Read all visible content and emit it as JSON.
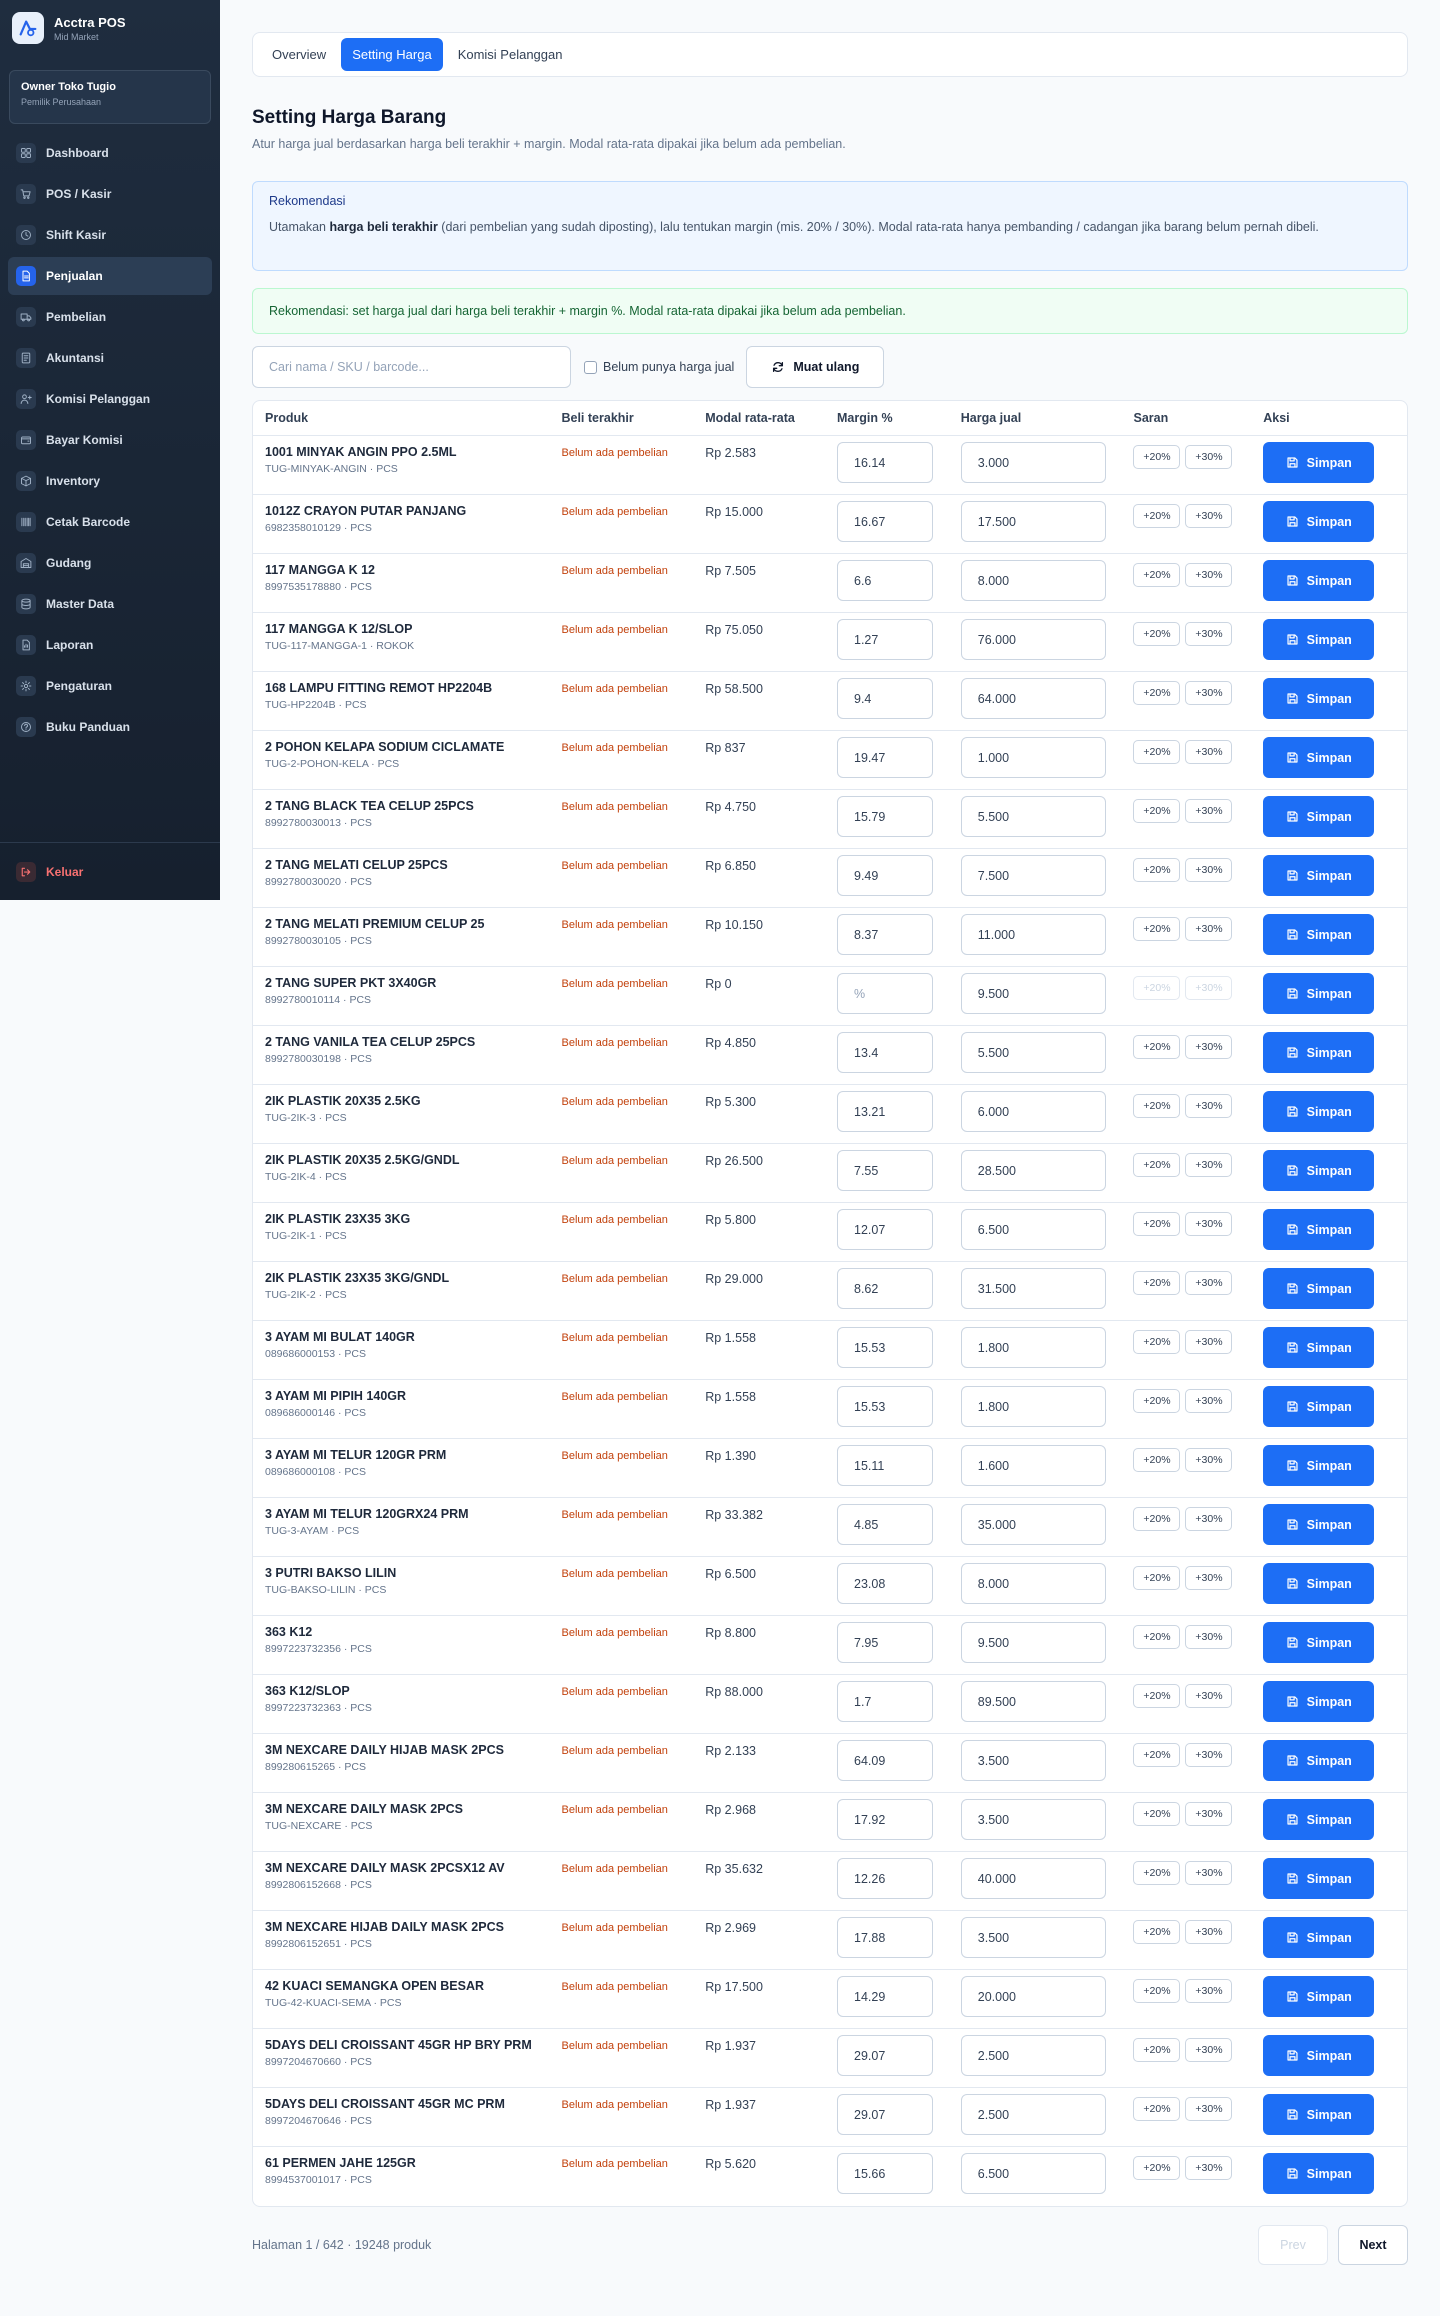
{
  "brand": {
    "name": "Acctra POS",
    "tier": "Mid Market"
  },
  "owner": {
    "name": "Owner Toko Tugio",
    "role": "Pemilik Perusahaan"
  },
  "nav": [
    {
      "label": "Dashboard",
      "icon": "dashboard-icon"
    },
    {
      "label": "POS / Kasir",
      "icon": "cart-icon"
    },
    {
      "label": "Shift Kasir",
      "icon": "clock-icon"
    },
    {
      "label": "Penjualan",
      "icon": "document-icon",
      "active": true
    },
    {
      "label": "Pembelian",
      "icon": "truck-icon"
    },
    {
      "label": "Akuntansi",
      "icon": "ledger-icon"
    },
    {
      "label": "Komisi Pelanggan",
      "icon": "user-commission-icon"
    },
    {
      "label": "Bayar Komisi",
      "icon": "wallet-icon"
    },
    {
      "label": "Inventory",
      "icon": "box-icon"
    },
    {
      "label": "Cetak Barcode",
      "icon": "barcode-icon"
    },
    {
      "label": "Gudang",
      "icon": "warehouse-icon"
    },
    {
      "label": "Master Data",
      "icon": "database-icon"
    },
    {
      "label": "Laporan",
      "icon": "report-icon"
    },
    {
      "label": "Pengaturan",
      "icon": "gear-icon"
    },
    {
      "label": "Buku Panduan",
      "icon": "help-icon"
    }
  ],
  "logout_label": "Keluar",
  "tabs": [
    {
      "label": "Overview"
    },
    {
      "label": "Setting Harga",
      "active": true
    },
    {
      "label": "Komisi Pelanggan"
    }
  ],
  "page": {
    "title": "Setting Harga Barang",
    "description": "Atur harga jual berdasarkan harga beli terakhir + margin. Modal rata-rata dipakai jika belum ada pembelian."
  },
  "info": {
    "title": "Rekomendasi",
    "text_before": "Utamakan ",
    "text_bold": "harga beli terakhir",
    "text_after": " (dari pembelian yang sudah diposting), lalu tentukan margin (mis. 20% / 30%). Modal rata-rata hanya pembanding / cadangan jika barang belum pernah dibeli."
  },
  "success_text": "Rekomendasi: set harga jual dari harga beli terakhir + margin %. Modal rata-rata dipakai jika belum ada pembelian.",
  "filters": {
    "search_placeholder": "Cari nama / SKU / barcode...",
    "checkbox_label": "Belum punya harga jual",
    "reload_label": "Muat ulang"
  },
  "table": {
    "headers": [
      "Produk",
      "Beli terakhir",
      "Modal rata-rata",
      "Margin %",
      "Harga jual",
      "Saran",
      "Aksi"
    ],
    "chip_20": "+20%",
    "chip_30": "+30%",
    "save_label": "Simpan",
    "margin_placeholder": "%",
    "rows": [
      {
        "name": "1001 MINYAK ANGIN PPO 2.5ML",
        "sku": "TUG-MINYAK-ANGIN · PCS",
        "beli": "Belum ada pembelian",
        "modal": "Rp 2.583",
        "margin": "16.14",
        "harga": "3.000"
      },
      {
        "name": "1012Z CRAYON PUTAR PANJANG",
        "sku": "6982358010129 · PCS",
        "beli": "Belum ada pembelian",
        "modal": "Rp 15.000",
        "margin": "16.67",
        "harga": "17.500"
      },
      {
        "name": "117 MANGGA K 12",
        "sku": "8997535178880 · PCS",
        "beli": "Belum ada pembelian",
        "modal": "Rp 7.505",
        "margin": "6.6",
        "harga": "8.000"
      },
      {
        "name": "117 MANGGA K 12/SLOP",
        "sku": "TUG-117-MANGGA-1 · ROKOK",
        "beli": "Belum ada pembelian",
        "modal": "Rp 75.050",
        "margin": "1.27",
        "harga": "76.000"
      },
      {
        "name": "168 LAMPU FITTING REMOT HP2204B",
        "sku": "TUG-HP2204B · PCS",
        "beli": "Belum ada pembelian",
        "modal": "Rp 58.500",
        "margin": "9.4",
        "harga": "64.000"
      },
      {
        "name": "2 POHON KELAPA SODIUM CICLAMATE",
        "sku": "TUG-2-POHON-KELA · PCS",
        "beli": "Belum ada pembelian",
        "modal": "Rp 837",
        "margin": "19.47",
        "harga": "1.000"
      },
      {
        "name": "2 TANG BLACK TEA CELUP 25PCS",
        "sku": "8992780030013 · PCS",
        "beli": "Belum ada pembelian",
        "modal": "Rp 4.750",
        "margin": "15.79",
        "harga": "5.500"
      },
      {
        "name": "2 TANG MELATI CELUP 25PCS",
        "sku": "8992780030020 · PCS",
        "beli": "Belum ada pembelian",
        "modal": "Rp 6.850",
        "margin": "9.49",
        "harga": "7.500"
      },
      {
        "name": "2 TANG MELATI PREMIUM CELUP 25",
        "sku": "8992780030105 · PCS",
        "beli": "Belum ada pembelian",
        "modal": "Rp 10.150",
        "margin": "8.37",
        "harga": "11.000"
      },
      {
        "name": "2 TANG SUPER PKT 3X40GR",
        "sku": "8992780010114 · PCS",
        "beli": "Belum ada pembelian",
        "modal": "Rp 0",
        "margin": "",
        "harga": "9.500",
        "disabled": true
      },
      {
        "name": "2 TANG VANILA TEA CELUP 25PCS",
        "sku": "8992780030198 · PCS",
        "beli": "Belum ada pembelian",
        "modal": "Rp 4.850",
        "margin": "13.4",
        "harga": "5.500"
      },
      {
        "name": "2IK PLASTIK 20X35 2.5KG",
        "sku": "TUG-2IK-3 · PCS",
        "beli": "Belum ada pembelian",
        "modal": "Rp 5.300",
        "margin": "13.21",
        "harga": "6.000"
      },
      {
        "name": "2IK PLASTIK 20X35 2.5KG/GNDL",
        "sku": "TUG-2IK-4 · PCS",
        "beli": "Belum ada pembelian",
        "modal": "Rp 26.500",
        "margin": "7.55",
        "harga": "28.500"
      },
      {
        "name": "2IK PLASTIK 23X35 3KG",
        "sku": "TUG-2IK-1 · PCS",
        "beli": "Belum ada pembelian",
        "modal": "Rp 5.800",
        "margin": "12.07",
        "harga": "6.500"
      },
      {
        "name": "2IK PLASTIK 23X35 3KG/GNDL",
        "sku": "TUG-2IK-2 · PCS",
        "beli": "Belum ada pembelian",
        "modal": "Rp 29.000",
        "margin": "8.62",
        "harga": "31.500"
      },
      {
        "name": "3 AYAM MI BULAT 140GR",
        "sku": "089686000153 · PCS",
        "beli": "Belum ada pembelian",
        "modal": "Rp 1.558",
        "margin": "15.53",
        "harga": "1.800"
      },
      {
        "name": "3 AYAM MI PIPIH 140GR",
        "sku": "089686000146 · PCS",
        "beli": "Belum ada pembelian",
        "modal": "Rp 1.558",
        "margin": "15.53",
        "harga": "1.800"
      },
      {
        "name": "3 AYAM MI TELUR 120GR PRM",
        "sku": "089686000108 · PCS",
        "beli": "Belum ada pembelian",
        "modal": "Rp 1.390",
        "margin": "15.11",
        "harga": "1.600"
      },
      {
        "name": "3 AYAM MI TELUR 120GRX24 PRM",
        "sku": "TUG-3-AYAM · PCS",
        "beli": "Belum ada pembelian",
        "modal": "Rp 33.382",
        "margin": "4.85",
        "harga": "35.000"
      },
      {
        "name": "3 PUTRI BAKSO LILIN",
        "sku": "TUG-BAKSO-LILIN · PCS",
        "beli": "Belum ada pembelian",
        "modal": "Rp 6.500",
        "margin": "23.08",
        "harga": "8.000"
      },
      {
        "name": "363 K12",
        "sku": "8997223732356 · PCS",
        "beli": "Belum ada pembelian",
        "modal": "Rp 8.800",
        "margin": "7.95",
        "harga": "9.500"
      },
      {
        "name": "363 K12/SLOP",
        "sku": "8997223732363 · PCS",
        "beli": "Belum ada pembelian",
        "modal": "Rp 88.000",
        "margin": "1.7",
        "harga": "89.500"
      },
      {
        "name": "3M NEXCARE DAILY HIJAB MASK 2PCS",
        "sku": "899280615265 · PCS",
        "beli": "Belum ada pembelian",
        "modal": "Rp 2.133",
        "margin": "64.09",
        "harga": "3.500"
      },
      {
        "name": "3M NEXCARE DAILY MASK 2PCS",
        "sku": "TUG-NEXCARE · PCS",
        "beli": "Belum ada pembelian",
        "modal": "Rp 2.968",
        "margin": "17.92",
        "harga": "3.500"
      },
      {
        "name": "3M NEXCARE DAILY MASK 2PCSX12 AV",
        "sku": "8992806152668 · PCS",
        "beli": "Belum ada pembelian",
        "modal": "Rp 35.632",
        "margin": "12.26",
        "harga": "40.000"
      },
      {
        "name": "3M NEXCARE HIJAB DAILY MASK 2PCS",
        "sku": "8992806152651 · PCS",
        "beli": "Belum ada pembelian",
        "modal": "Rp 2.969",
        "margin": "17.88",
        "harga": "3.500"
      },
      {
        "name": "42 KUACI SEMANGKA OPEN BESAR",
        "sku": "TUG-42-KUACI-SEMA · PCS",
        "beli": "Belum ada pembelian",
        "modal": "Rp 17.500",
        "margin": "14.29",
        "harga": "20.000"
      },
      {
        "name": "5DAYS DELI CROISSANT 45GR HP BRY PRM",
        "sku": "8997204670660 · PCS",
        "beli": "Belum ada pembelian",
        "modal": "Rp 1.937",
        "margin": "29.07",
        "harga": "2.500"
      },
      {
        "name": "5DAYS DELI CROISSANT 45GR MC PRM",
        "sku": "8997204670646 · PCS",
        "beli": "Belum ada pembelian",
        "modal": "Rp 1.937",
        "margin": "29.07",
        "harga": "2.500"
      },
      {
        "name": "61 PERMEN JAHE 125GR",
        "sku": "8994537001017 · PCS",
        "beli": "Belum ada pembelian",
        "modal": "Rp 5.620",
        "margin": "15.66",
        "harga": "6.500"
      }
    ]
  },
  "pagination": {
    "info": "Halaman 1 / 642 · 19248 produk",
    "prev": "Prev",
    "next": "Next"
  },
  "colors": {
    "primary": "#1d6ef5",
    "sidebar": "#1f2d3f",
    "warning_text": "#c2410c",
    "logout": "#f87171"
  }
}
